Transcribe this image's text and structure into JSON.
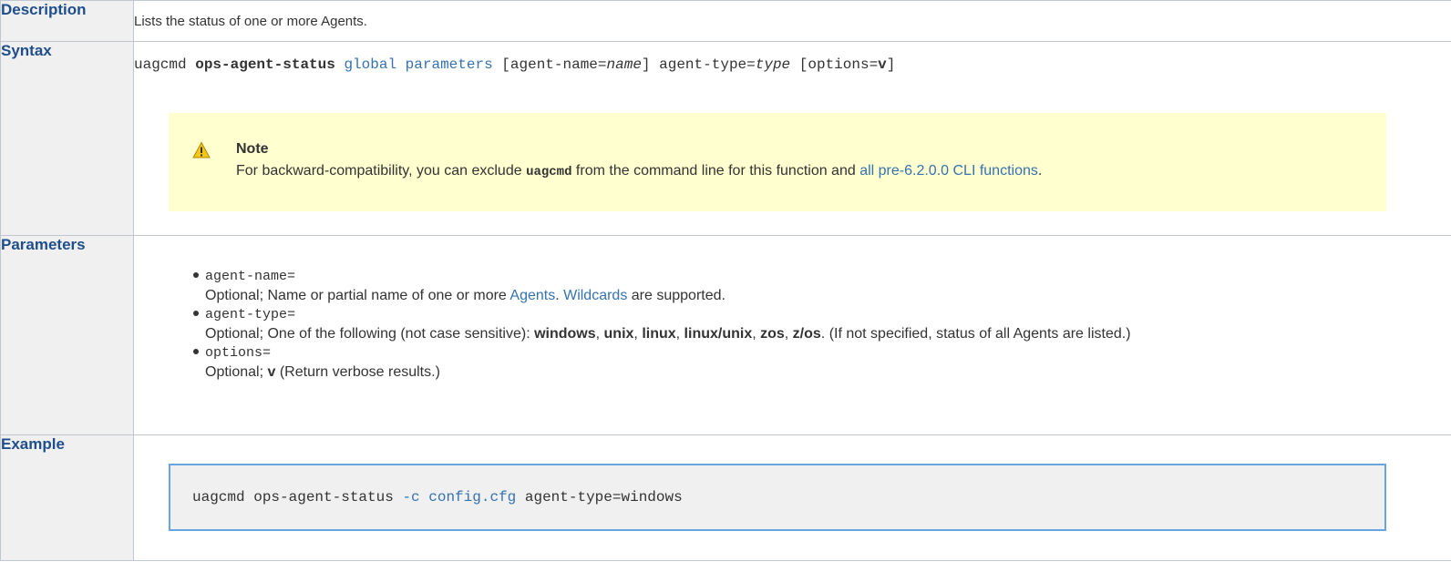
{
  "rows": {
    "description": {
      "label": "Description",
      "text": "Lists the status of one or more Agents."
    },
    "syntax": {
      "label": "Syntax",
      "cmd": "uagcmd ",
      "op": "ops-agent-status",
      "sp1": " ",
      "global_link": "global parameters",
      "seg1": " [agent-name=",
      "name_var": "name",
      "seg2": "] agent-type=",
      "type_var": "type",
      "seg3": " [options=",
      "v": "v",
      "seg4": "]",
      "note": {
        "icon": "warning-icon",
        "title": "Note",
        "text1": "For backward-compatibility, you can exclude ",
        "code": "uagcmd",
        "text2": " from the command line for this function and ",
        "link": "all pre-6.2.0.0 CLI functions",
        "text3": "."
      }
    },
    "parameters": {
      "label": "Parameters",
      "items": [
        {
          "name": "agent-name=",
          "d1": "Optional; Name or partial name of one or more ",
          "l1": "Agents",
          "d2": ". ",
          "l2": "Wildcards",
          "d3": " are supported."
        },
        {
          "name": "agent-type=",
          "d1": "Optional; One of the following (not case sensitive): ",
          "b1": "windows",
          "c1": ", ",
          "b2": "unix",
          "c2": ", ",
          "b3": "linux",
          "c3": ", ",
          "b4": "linux/unix",
          "c4": ", ",
          "b5": "zos",
          "c5": ", ",
          "b6": "z/os",
          "d2": ". (If not specified, status of all Agents are listed.)"
        },
        {
          "name": "options=",
          "d1": "Optional; ",
          "b1": "v",
          "d2": " (Return verbose results.)"
        }
      ]
    },
    "example": {
      "label": "Example",
      "c1": "uagcmd ops-agent-status ",
      "c2": "-c",
      "c3": " ",
      "c4": "config.cfg",
      "c5": " agent-type=windows"
    }
  },
  "colors": {
    "header_bg": "#f0f0f0",
    "header_text": "#1f4e8c",
    "link": "#3572b0",
    "note_bg": "#ffffcf",
    "code_border": "#6aa4e0",
    "code_bg": "#f0f0f0"
  }
}
